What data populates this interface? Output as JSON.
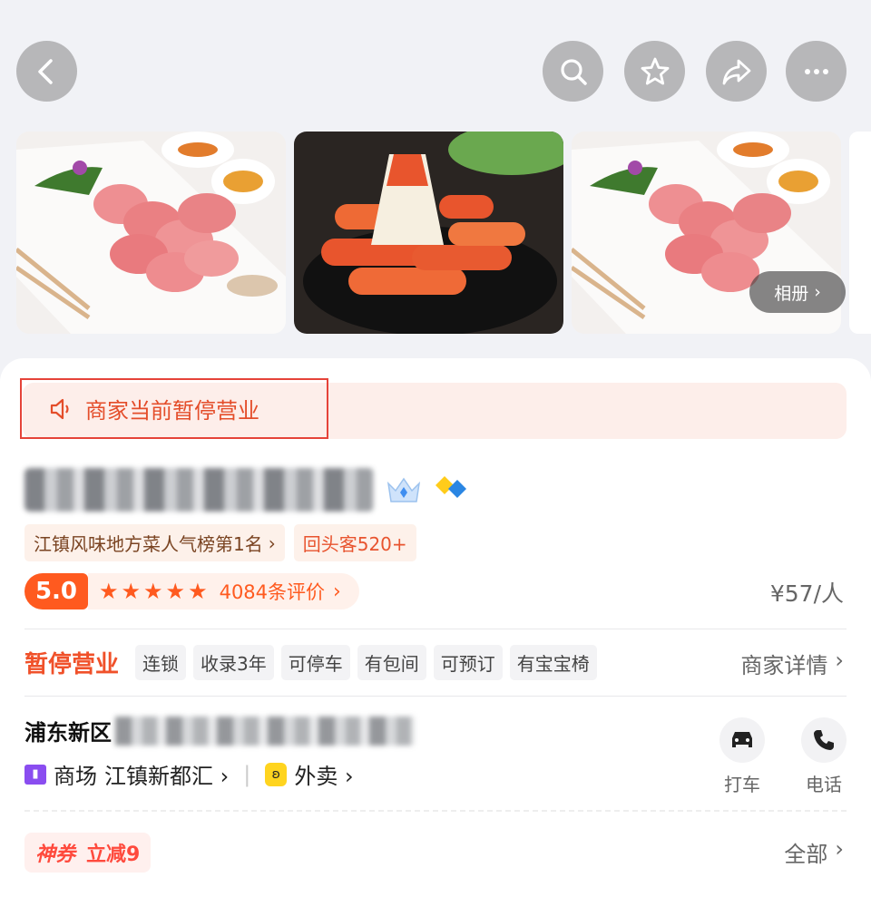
{
  "nav": {
    "back_icon": "chevron-left-icon",
    "search_icon": "search-icon",
    "favorite_icon": "star-icon",
    "share_icon": "share-icon",
    "more_icon": "more-icon"
  },
  "gallery": {
    "photos": [
      "lamb-rolls-photo",
      "crab-sticks-photo",
      "lamb-rolls-photo"
    ],
    "album_label": "相册"
  },
  "notice": {
    "text": "商家当前暂停营业",
    "icon": "speaker-icon"
  },
  "shop": {
    "name_blurred": true,
    "badges": [
      "crown-badge-icon",
      "diamond-badge-icon"
    ],
    "rank_tag": "江镇风味地方菜人气榜第1名",
    "return_tag": "回头客520+",
    "score": "5.0",
    "stars": 5,
    "review_count": "4084条评价",
    "price": "¥57/人"
  },
  "status": {
    "label": "暂停营业",
    "features": [
      "连锁",
      "收录3年",
      "可停车",
      "有包间",
      "可预订",
      "有宝宝椅"
    ],
    "detail_link": "商家详情"
  },
  "address": {
    "district": "浦东新区",
    "mall_prefix": "商场",
    "mall_name": "江镇新都汇",
    "takeout": "外卖"
  },
  "actions": {
    "taxi": "打车",
    "phone": "电话"
  },
  "coupon": {
    "tag": "神券",
    "text": "立减9",
    "all_link": "全部"
  },
  "colors": {
    "accent": "#ff5a1f",
    "notice_red": "#e54339",
    "page_bg": "#f1f2f6"
  }
}
